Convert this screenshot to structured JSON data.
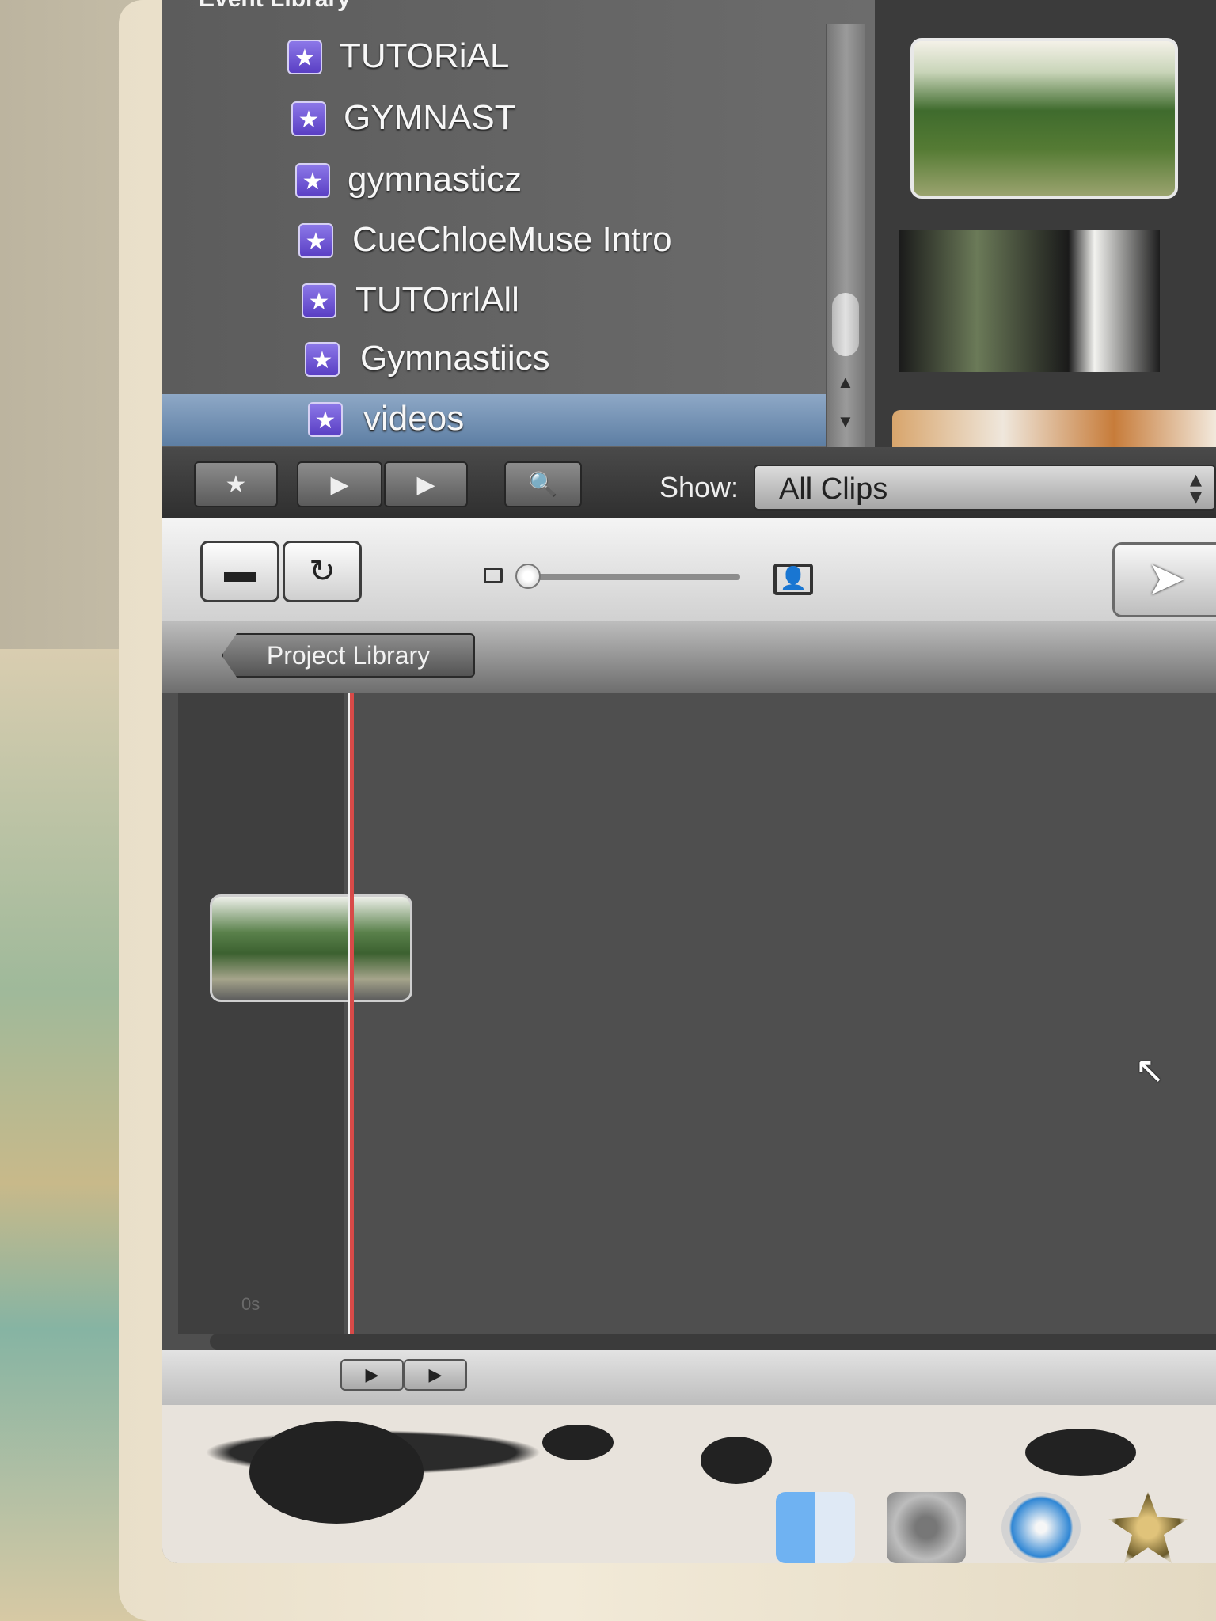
{
  "event_library": {
    "title": "Event Library",
    "items": [
      {
        "label": "TUTORiAL",
        "selected": false
      },
      {
        "label": "GYMNAST",
        "selected": false
      },
      {
        "label": "gymnasticz",
        "selected": false
      },
      {
        "label": "CueChloeMuse Intro",
        "selected": false
      },
      {
        "label": "TUTOrrlAll",
        "selected": false
      },
      {
        "label": "Gymnastiics",
        "selected": false
      },
      {
        "label": "videos",
        "selected": true
      }
    ]
  },
  "toolbar": {
    "show_label": "Show:",
    "show_value": "All Clips"
  },
  "project_library": {
    "back_label": "Project Library",
    "time_label": "0s"
  },
  "icons": {
    "event_star": "★",
    "play": "▶",
    "search": "🔍",
    "camera": "▬",
    "rotate": "↻",
    "person": "👤",
    "pointer": "➤",
    "cursor": "↖"
  },
  "colors": {
    "selection": "#6f8db1",
    "playhead": "#d84a48",
    "star_badge": "#6a50d4"
  }
}
